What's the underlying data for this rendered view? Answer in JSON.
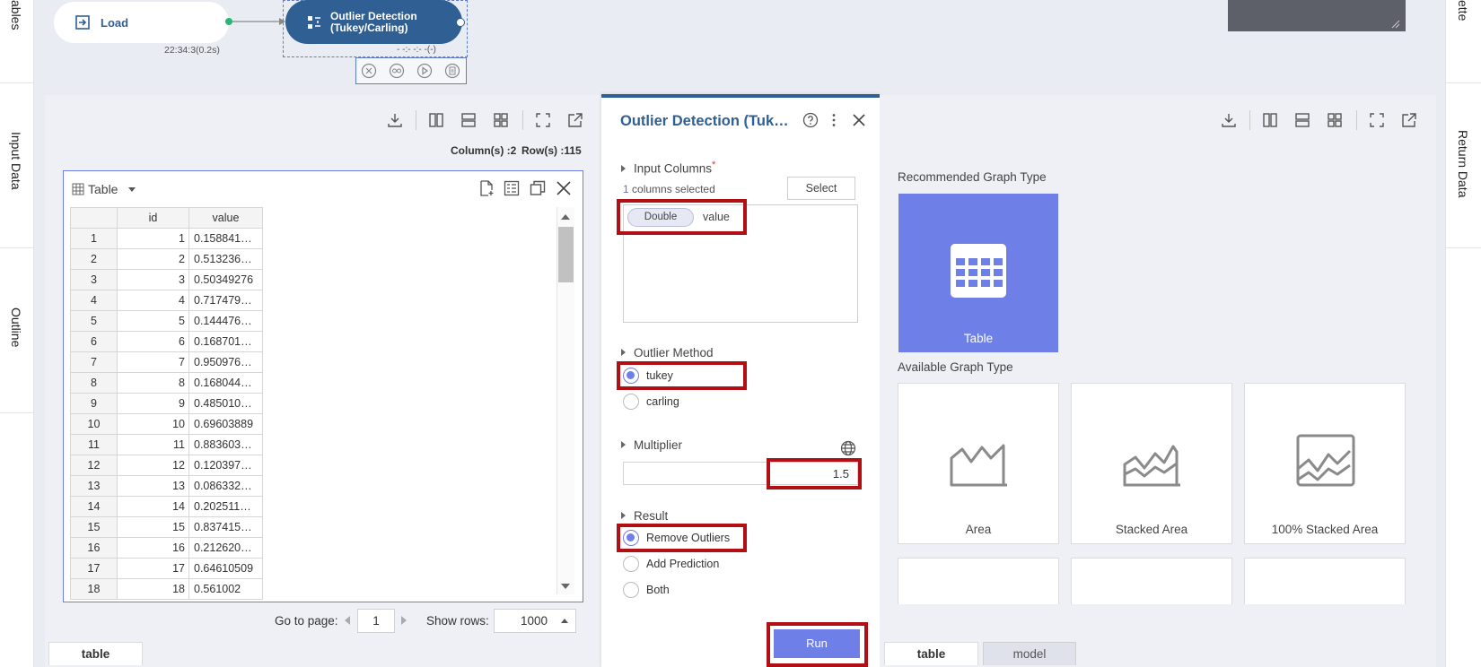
{
  "side_tabs": {
    "left_top": "ables",
    "left_input": "Input Data",
    "left_outline": "Outline",
    "right_top": "ette",
    "right_return": "Return Data"
  },
  "flow": {
    "load_label": "Load",
    "load_time": "22:34:3(0.2s)",
    "outlier_label_1": "Outlier Detection",
    "outlier_label_2": "(Tukey/Carling)",
    "outlier_time": "- -:- -:- -(-)"
  },
  "left_panel": {
    "columns_label": "Column(s) :2",
    "rows_label": "Row(s) :115",
    "table_title": "Table",
    "headers": [
      "",
      "id",
      "value"
    ],
    "rows": [
      [
        "1",
        "1",
        "0.158841…"
      ],
      [
        "2",
        "2",
        "0.513236…"
      ],
      [
        "3",
        "3",
        "0.50349276"
      ],
      [
        "4",
        "4",
        "0.717479…"
      ],
      [
        "5",
        "5",
        "0.144476…"
      ],
      [
        "6",
        "6",
        "0.168701…"
      ],
      [
        "7",
        "7",
        "0.950976…"
      ],
      [
        "8",
        "8",
        "0.168044…"
      ],
      [
        "9",
        "9",
        "0.485010…"
      ],
      [
        "10",
        "10",
        "0.69603889"
      ],
      [
        "11",
        "11",
        "0.883603…"
      ],
      [
        "12",
        "12",
        "0.120397…"
      ],
      [
        "13",
        "13",
        "0.086332…"
      ],
      [
        "14",
        "14",
        "0.202511…"
      ],
      [
        "15",
        "15",
        "0.837415…"
      ],
      [
        "16",
        "16",
        "0.212620…"
      ],
      [
        "17",
        "17",
        "0.64610509"
      ],
      [
        "18",
        "18",
        "0.561002"
      ]
    ],
    "goto_label": "Go to page:",
    "page_value": "1",
    "show_rows_label": "Show rows:",
    "show_rows_value": "1000",
    "bottom_tab": "table"
  },
  "config_panel": {
    "title": "Outlier Detection (Tuk…",
    "input_columns_label": "Input Columns",
    "required_mark": "*",
    "selected_count": "1",
    "selected_text": "columns selected",
    "select_button": "Select",
    "column_type": "Double",
    "column_name": "value",
    "outlier_method_label": "Outlier Method",
    "method_tukey": "tukey",
    "method_carling": "carling",
    "multiplier_label": "Multiplier",
    "multiplier_value": "1.5",
    "result_label": "Result",
    "result_remove": "Remove Outliers",
    "result_add": "Add Prediction",
    "result_both": "Both",
    "run_button": "Run"
  },
  "right_panel": {
    "recommended_label": "Recommended Graph Type",
    "recommended_card": "Table",
    "available_label": "Available Graph Type",
    "cards": [
      "Area",
      "Stacked Area",
      "100% Stacked Area"
    ],
    "tab_table": "table",
    "tab_model": "model"
  },
  "colors": {
    "accent": "#6f7fe8",
    "node_blue": "#2f5f93",
    "highlight_red": "#b10f14"
  }
}
